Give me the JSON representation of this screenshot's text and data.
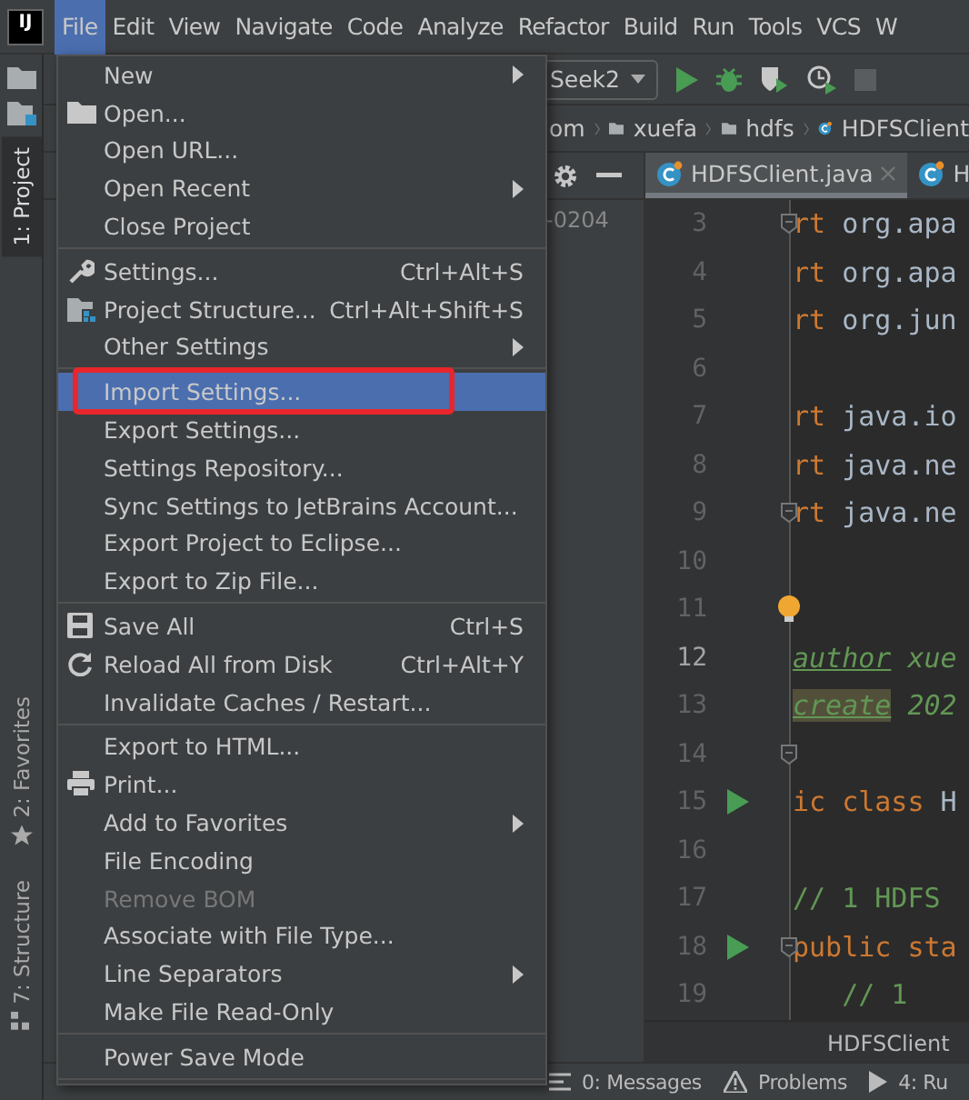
{
  "logo": "IJ",
  "menu_bar": [
    {
      "label": "File",
      "selected": true
    },
    {
      "label": "Edit",
      "selected": false
    },
    {
      "label": "View",
      "selected": false
    },
    {
      "label": "Navigate",
      "selected": false
    },
    {
      "label": "Code",
      "selected": false
    },
    {
      "label": "Analyze",
      "selected": false
    },
    {
      "label": "Refactor",
      "selected": false
    },
    {
      "label": "Build",
      "selected": false
    },
    {
      "label": "Run",
      "selected": false
    },
    {
      "label": "Tools",
      "selected": false
    },
    {
      "label": "VCS",
      "selected": false
    },
    {
      "label": "W",
      "selected": false
    }
  ],
  "toolbar": {
    "run_config": "Seek2"
  },
  "breadcrumb": [
    {
      "label": "om",
      "kind": "text"
    },
    {
      "label": "xuefa",
      "kind": "folder"
    },
    {
      "label": "hdfs",
      "kind": "folder"
    },
    {
      "label": "HDFSClient",
      "kind": "class"
    }
  ],
  "left_strip": {
    "top": [
      {
        "label": "1: Project",
        "selected": true
      }
    ],
    "bottom": [
      {
        "label": "2: Favorites",
        "selected": false
      },
      {
        "label": "7: Structure",
        "selected": false
      }
    ]
  },
  "project_panel": {
    "visible_text": "-0204"
  },
  "editor_tabs": [
    {
      "label": "HDFSClient.java",
      "selected": true,
      "closable": true
    },
    {
      "label": "H",
      "selected": false,
      "closable": false
    }
  ],
  "code_lines": [
    {
      "number": "3",
      "current": false,
      "fold": true,
      "tokens": [
        {
          "text": "rt",
          "kind": "kw"
        },
        {
          "text": " org.apa",
          "kind": "plain"
        }
      ]
    },
    {
      "number": "4",
      "current": false,
      "tokens": [
        {
          "text": "rt",
          "kind": "kw"
        },
        {
          "text": " org.apa",
          "kind": "plain"
        }
      ]
    },
    {
      "number": "5",
      "current": false,
      "tokens": [
        {
          "text": "rt",
          "kind": "kw"
        },
        {
          "text": " org.jun",
          "kind": "plain"
        }
      ]
    },
    {
      "number": "6",
      "current": false
    },
    {
      "number": "7",
      "current": false,
      "tokens": [
        {
          "text": "rt",
          "kind": "kw"
        },
        {
          "text": " java.io",
          "kind": "plain"
        }
      ]
    },
    {
      "number": "8",
      "current": false,
      "tokens": [
        {
          "text": "rt",
          "kind": "kw"
        },
        {
          "text": " java.ne",
          "kind": "plain"
        }
      ]
    },
    {
      "number": "9",
      "current": false,
      "fold": true,
      "tokens": [
        {
          "text": "rt",
          "kind": "kw"
        },
        {
          "text": " java.ne",
          "kind": "plain"
        }
      ]
    },
    {
      "number": "10",
      "current": false
    },
    {
      "number": "11",
      "current": false,
      "bulb": true
    },
    {
      "number": "12",
      "current": true,
      "tokens": [
        {
          "text": "author",
          "kind": "doctag"
        },
        {
          "text": " xue",
          "kind": "doc"
        }
      ]
    },
    {
      "number": "13",
      "current": false,
      "tokens": [
        {
          "text": "create",
          "kind": "doctag_marked"
        },
        {
          "text": " 202",
          "kind": "doc"
        }
      ]
    },
    {
      "number": "14",
      "current": false,
      "fold": true
    },
    {
      "number": "15",
      "current": false,
      "run": true,
      "tokens": [
        {
          "text": "ic class",
          "kind": "kw"
        },
        {
          "text": " H",
          "kind": "plain"
        }
      ]
    },
    {
      "number": "16",
      "current": false
    },
    {
      "number": "17",
      "current": false,
      "tokens": [
        {
          "text": "// 1 HDFS",
          "kind": "comment"
        }
      ]
    },
    {
      "number": "18",
      "current": false,
      "fold": true,
      "run": true,
      "tokens": [
        {
          "text": "public sta",
          "kind": "kw"
        }
      ]
    },
    {
      "number": "19",
      "current": false,
      "tokens": [
        {
          "text": "   // 1",
          "kind": "comment"
        }
      ]
    }
  ],
  "editor_breadcrumb": "HDFSClient",
  "status_bar": [
    {
      "label": "0: Messages"
    },
    {
      "label": "Problems"
    },
    {
      "label": "4: Ru"
    }
  ],
  "file_menu": [
    {
      "kind": "item",
      "label": "New",
      "submenu": true,
      "selected": false,
      "disabled": false,
      "boxed": false
    },
    {
      "kind": "item",
      "label": "Open...",
      "submenu": false,
      "selected": false,
      "disabled": false,
      "boxed": false
    },
    {
      "kind": "item",
      "label": "Open URL...",
      "submenu": false,
      "selected": false,
      "disabled": false,
      "boxed": false
    },
    {
      "kind": "item",
      "label": "Open Recent",
      "submenu": true,
      "selected": false,
      "disabled": false,
      "boxed": false
    },
    {
      "kind": "item",
      "label": "Close Project",
      "submenu": false,
      "selected": false,
      "disabled": false,
      "boxed": false
    },
    {
      "kind": "separator"
    },
    {
      "kind": "item",
      "label": "Settings...",
      "shortcut": "Ctrl+Alt+S",
      "submenu": false,
      "selected": false,
      "disabled": false,
      "boxed": false
    },
    {
      "kind": "item",
      "label": "Project Structure...",
      "shortcut": "Ctrl+Alt+Shift+S",
      "submenu": false,
      "selected": false,
      "disabled": false,
      "boxed": false
    },
    {
      "kind": "item",
      "label": "Other Settings",
      "submenu": true,
      "selected": false,
      "disabled": false,
      "boxed": false
    },
    {
      "kind": "separator"
    },
    {
      "kind": "item",
      "label": "Import Settings...",
      "submenu": false,
      "selected": true,
      "disabled": false,
      "boxed": true
    },
    {
      "kind": "item",
      "label": "Export Settings...",
      "submenu": false,
      "selected": false,
      "disabled": false,
      "boxed": false
    },
    {
      "kind": "item",
      "label": "Settings Repository...",
      "submenu": false,
      "selected": false,
      "disabled": false,
      "boxed": false
    },
    {
      "kind": "item",
      "label": "Sync Settings to JetBrains Account...",
      "submenu": false,
      "selected": false,
      "disabled": false,
      "boxed": false
    },
    {
      "kind": "item",
      "label": "Export Project to Eclipse...",
      "submenu": false,
      "selected": false,
      "disabled": false,
      "boxed": false
    },
    {
      "kind": "item",
      "label": "Export to Zip File...",
      "submenu": false,
      "selected": false,
      "disabled": false,
      "boxed": false
    },
    {
      "kind": "separator"
    },
    {
      "kind": "item",
      "label": "Save All",
      "shortcut": "Ctrl+S",
      "submenu": false,
      "selected": false,
      "disabled": false,
      "boxed": false
    },
    {
      "kind": "item",
      "label": "Reload All from Disk",
      "shortcut": "Ctrl+Alt+Y",
      "submenu": false,
      "selected": false,
      "disabled": false,
      "boxed": false
    },
    {
      "kind": "item",
      "label": "Invalidate Caches / Restart...",
      "submenu": false,
      "selected": false,
      "disabled": false,
      "boxed": false
    },
    {
      "kind": "separator"
    },
    {
      "kind": "item",
      "label": "Export to HTML...",
      "submenu": false,
      "selected": false,
      "disabled": false,
      "boxed": false
    },
    {
      "kind": "item",
      "label": "Print...",
      "submenu": false,
      "selected": false,
      "disabled": false,
      "boxed": false
    },
    {
      "kind": "item",
      "label": "Add to Favorites",
      "submenu": true,
      "selected": false,
      "disabled": false,
      "boxed": false
    },
    {
      "kind": "item",
      "label": "File Encoding",
      "submenu": false,
      "selected": false,
      "disabled": false,
      "boxed": false
    },
    {
      "kind": "item",
      "label": "Remove BOM",
      "submenu": false,
      "selected": false,
      "disabled": true,
      "boxed": false
    },
    {
      "kind": "item",
      "label": "Associate with File Type...",
      "submenu": false,
      "selected": false,
      "disabled": false,
      "boxed": false
    },
    {
      "kind": "item",
      "label": "Line Separators",
      "submenu": true,
      "selected": false,
      "disabled": false,
      "boxed": false
    },
    {
      "kind": "item",
      "label": "Make File Read-Only",
      "submenu": false,
      "selected": false,
      "disabled": false,
      "boxed": false
    },
    {
      "kind": "separator"
    },
    {
      "kind": "item",
      "label": "Power Save Mode",
      "submenu": false,
      "selected": false,
      "disabled": false,
      "boxed": false
    },
    {
      "kind": "separator"
    }
  ]
}
